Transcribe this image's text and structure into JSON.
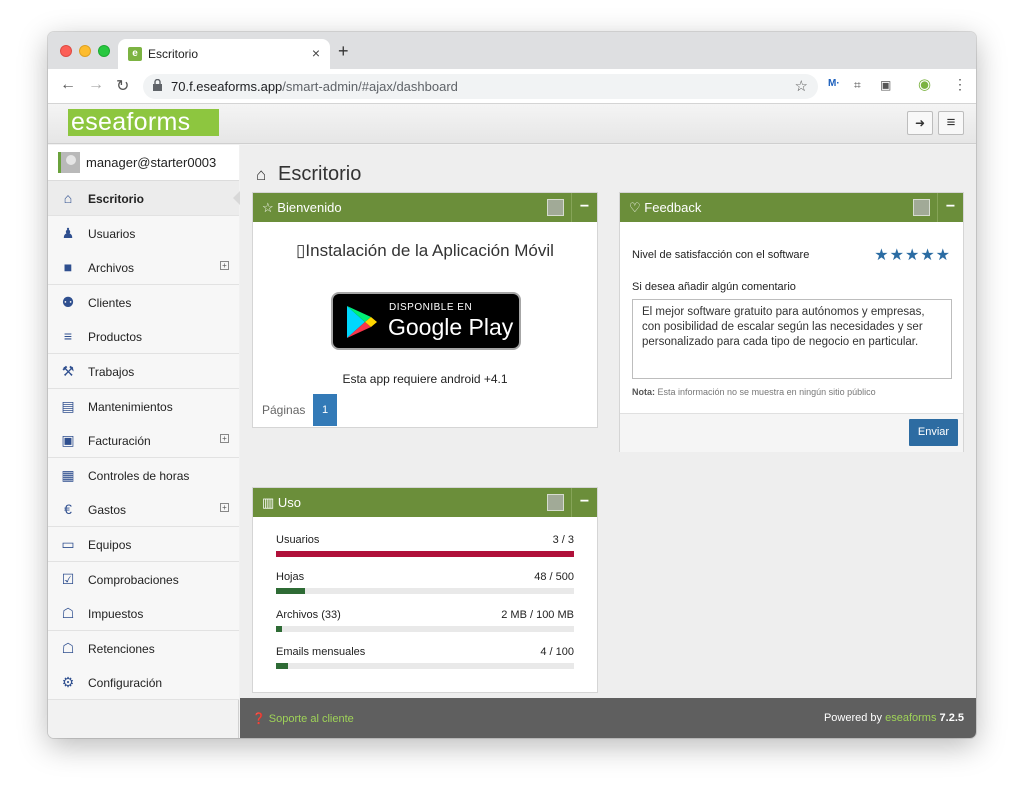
{
  "browser": {
    "tab_title": "Escritorio",
    "url_host": "70.f.eseaforms.app",
    "url_path": "/smart-admin/#ajax/dashboard"
  },
  "app": {
    "logo": "eseaforms",
    "user": "manager@starter0003"
  },
  "sidebar": {
    "items": [
      {
        "label": "Escritorio",
        "icon": "home-icon",
        "glyph": "⌂",
        "active": true,
        "expandable": false
      },
      {
        "label": "Usuarios",
        "icon": "user-icon",
        "glyph": "♟",
        "active": false,
        "expandable": false
      },
      {
        "label": "Archivos",
        "icon": "book-icon",
        "glyph": "■",
        "active": false,
        "expandable": true
      },
      {
        "label": "Clientes",
        "icon": "users-icon",
        "glyph": "⚉",
        "active": false,
        "expandable": false
      },
      {
        "label": "Productos",
        "icon": "cart-icon",
        "glyph": "≡",
        "active": false,
        "expandable": false
      },
      {
        "label": "Trabajos",
        "icon": "paint-roller-icon",
        "glyph": "⚒",
        "active": false,
        "expandable": false
      },
      {
        "label": "Mantenimientos",
        "icon": "document-icon",
        "glyph": "▤",
        "active": false,
        "expandable": false
      },
      {
        "label": "Facturación",
        "icon": "money-icon",
        "glyph": "▣",
        "active": false,
        "expandable": true
      },
      {
        "label": "Controles de horas",
        "icon": "calendar-icon",
        "glyph": "▦",
        "active": false,
        "expandable": false
      },
      {
        "label": "Gastos",
        "icon": "euro-icon",
        "glyph": "€",
        "active": false,
        "expandable": true
      },
      {
        "label": "Equipos",
        "icon": "laptop-icon",
        "glyph": "▭",
        "active": false,
        "expandable": false
      },
      {
        "label": "Comprobaciones",
        "icon": "checkbox-icon",
        "glyph": "☑",
        "active": false,
        "expandable": false
      },
      {
        "label": "Impuestos",
        "icon": "bank-icon",
        "glyph": "☖",
        "active": false,
        "expandable": false
      },
      {
        "label": "Retenciones",
        "icon": "bank-icon",
        "glyph": "☖",
        "active": false,
        "expandable": false
      },
      {
        "label": "Configuración",
        "icon": "gear-icon",
        "glyph": "⚙",
        "active": false,
        "expandable": false
      }
    ]
  },
  "main": {
    "title": "Escritorio",
    "bienvenido": {
      "title": "Bienvenido",
      "mobile_title": "Instalación de la Aplicación Móvil",
      "badge_small": "DISPONIBLE EN",
      "badge_big": "Google Play",
      "requirement": "Esta app requiere android +4.1",
      "pages_label": "Páginas",
      "current_page": "1"
    },
    "feedback": {
      "title": "Feedback",
      "satisfaction_label": "Nivel de satisfacción con el software",
      "stars": "★★★★★",
      "rating": 5,
      "comment_label": "Si desea añadir algún comentario",
      "comment": "El mejor software gratuito para autónomos y empresas, con posibilidad de escalar según las necesidades y ser personalizado para cada tipo de negocio en particular.",
      "note_bold": "Nota:",
      "note": "Esta información no se muestra en ningún sitio público",
      "send": "Enviar"
    },
    "uso": {
      "title": "Uso",
      "rows": [
        {
          "label": "Usuarios",
          "value": "3 / 3",
          "fraction": 1.0,
          "color": "#b0103a"
        },
        {
          "label": "Hojas",
          "value": "48 / 500",
          "fraction": 0.096,
          "color": "#2e6b35"
        },
        {
          "label": "Archivos (33)",
          "value": "2 MB / 100 MB",
          "fraction": 0.02,
          "color": "#2e6b35"
        },
        {
          "label": "Emails mensuales",
          "value": "4 / 100",
          "fraction": 0.04,
          "color": "#2e6b35"
        }
      ]
    }
  },
  "footer": {
    "support": "Soporte al cliente",
    "powered_by": "Powered by",
    "brand": "eseaforms",
    "version": "7.2.5"
  },
  "colors": {
    "accent_green": "#8dc63f",
    "widget_header": "#6b8e3a",
    "link_blue": "#337ab7"
  }
}
